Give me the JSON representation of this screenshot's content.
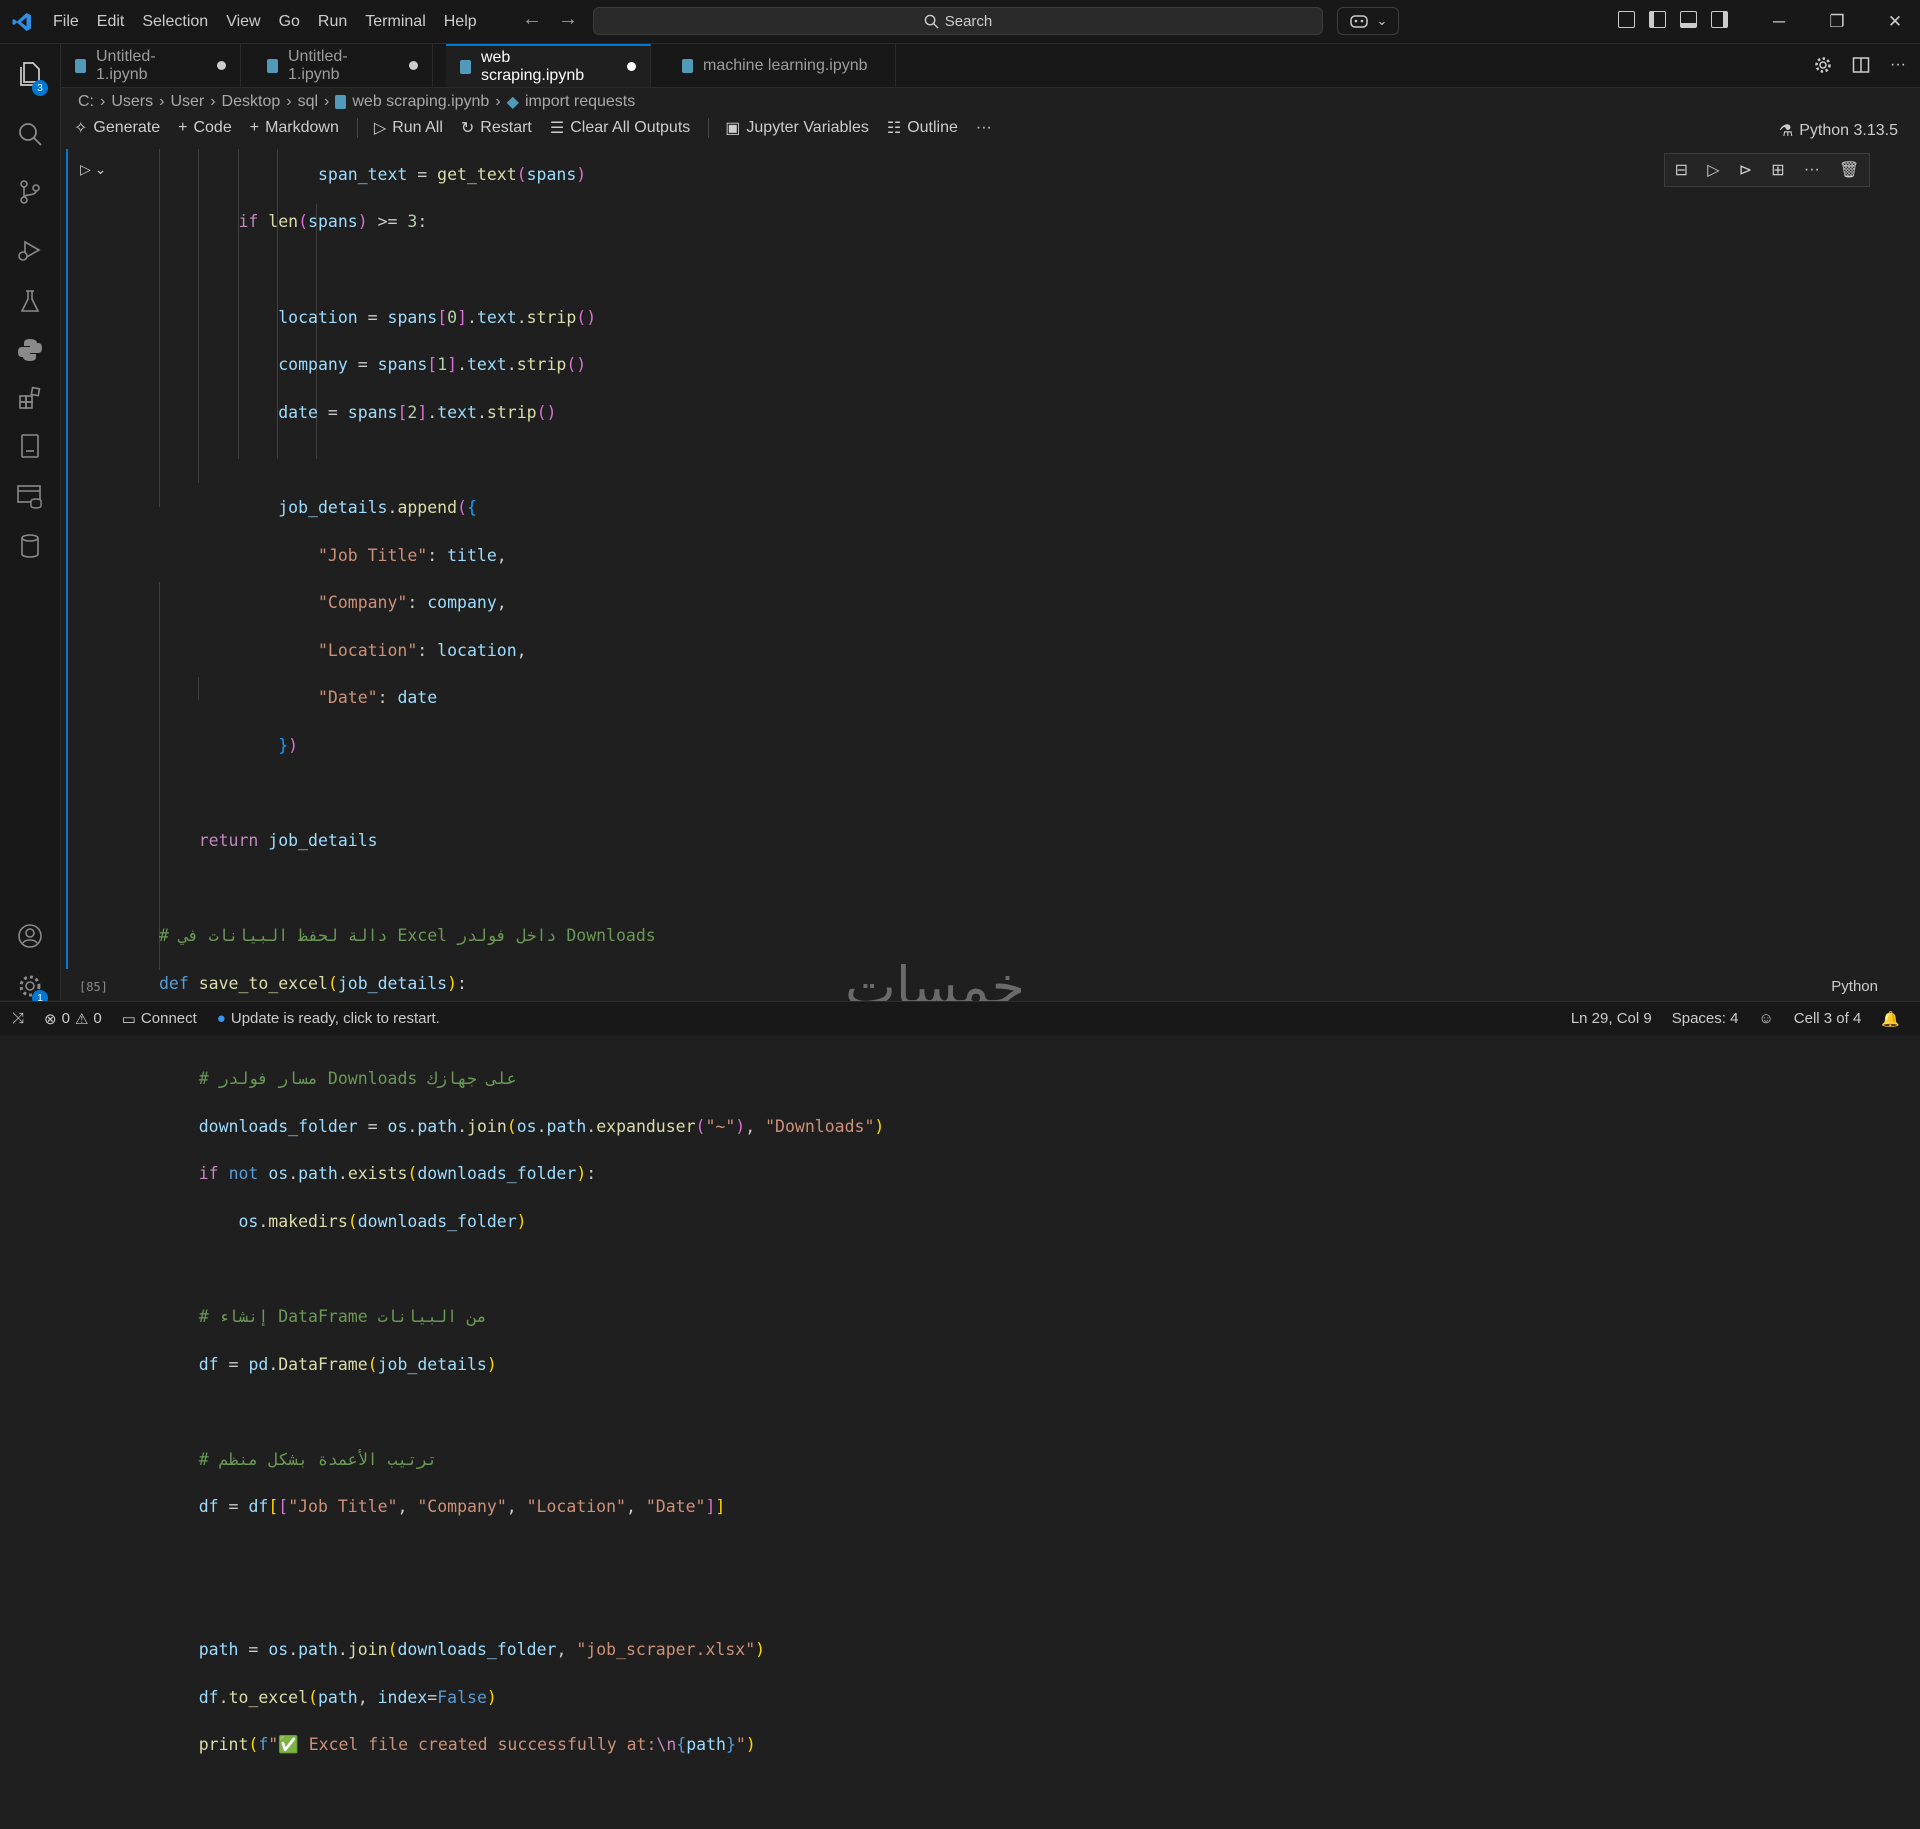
{
  "titlebar": {
    "menu": [
      "File",
      "Edit",
      "Selection",
      "View",
      "Go",
      "Run",
      "Terminal",
      "Help"
    ],
    "search_label": "Search"
  },
  "activity": {
    "explorer_badge": "3",
    "settings_badge": "1"
  },
  "tabs": [
    {
      "label": "Untitled-1.ipynb",
      "modified": true,
      "active": false
    },
    {
      "label": "Untitled-1.ipynb",
      "modified": true,
      "active": false
    },
    {
      "label": "web scraping.ipynb",
      "modified": true,
      "active": true
    },
    {
      "label": "machine learning.ipynb",
      "modified": false,
      "active": false
    }
  ],
  "breadcrumb": [
    "C:",
    "Users",
    "User",
    "Desktop",
    "sql",
    "web scraping.ipynb",
    "import requests"
  ],
  "toolbar": {
    "generate": "Generate",
    "code": "Code",
    "markdown": "Markdown",
    "run_all": "Run All",
    "restart": "Restart",
    "clear_all_outputs": "Clear All Outputs",
    "jupyter_variables": "Jupyter Variables",
    "outline": "Outline",
    "more": "···",
    "kernel": "Python 3.13.5"
  },
  "cell": {
    "exec_count": "[85]",
    "language": "Python"
  },
  "watermark": "خمسات",
  "status": {
    "errors": "0",
    "warnings": "0",
    "connect": "Connect",
    "update": "Update is ready, click to restart.",
    "position": "Ln 29, Col 9",
    "spaces": "Spaces: 4",
    "cell_info": "Cell 3 of 4"
  }
}
